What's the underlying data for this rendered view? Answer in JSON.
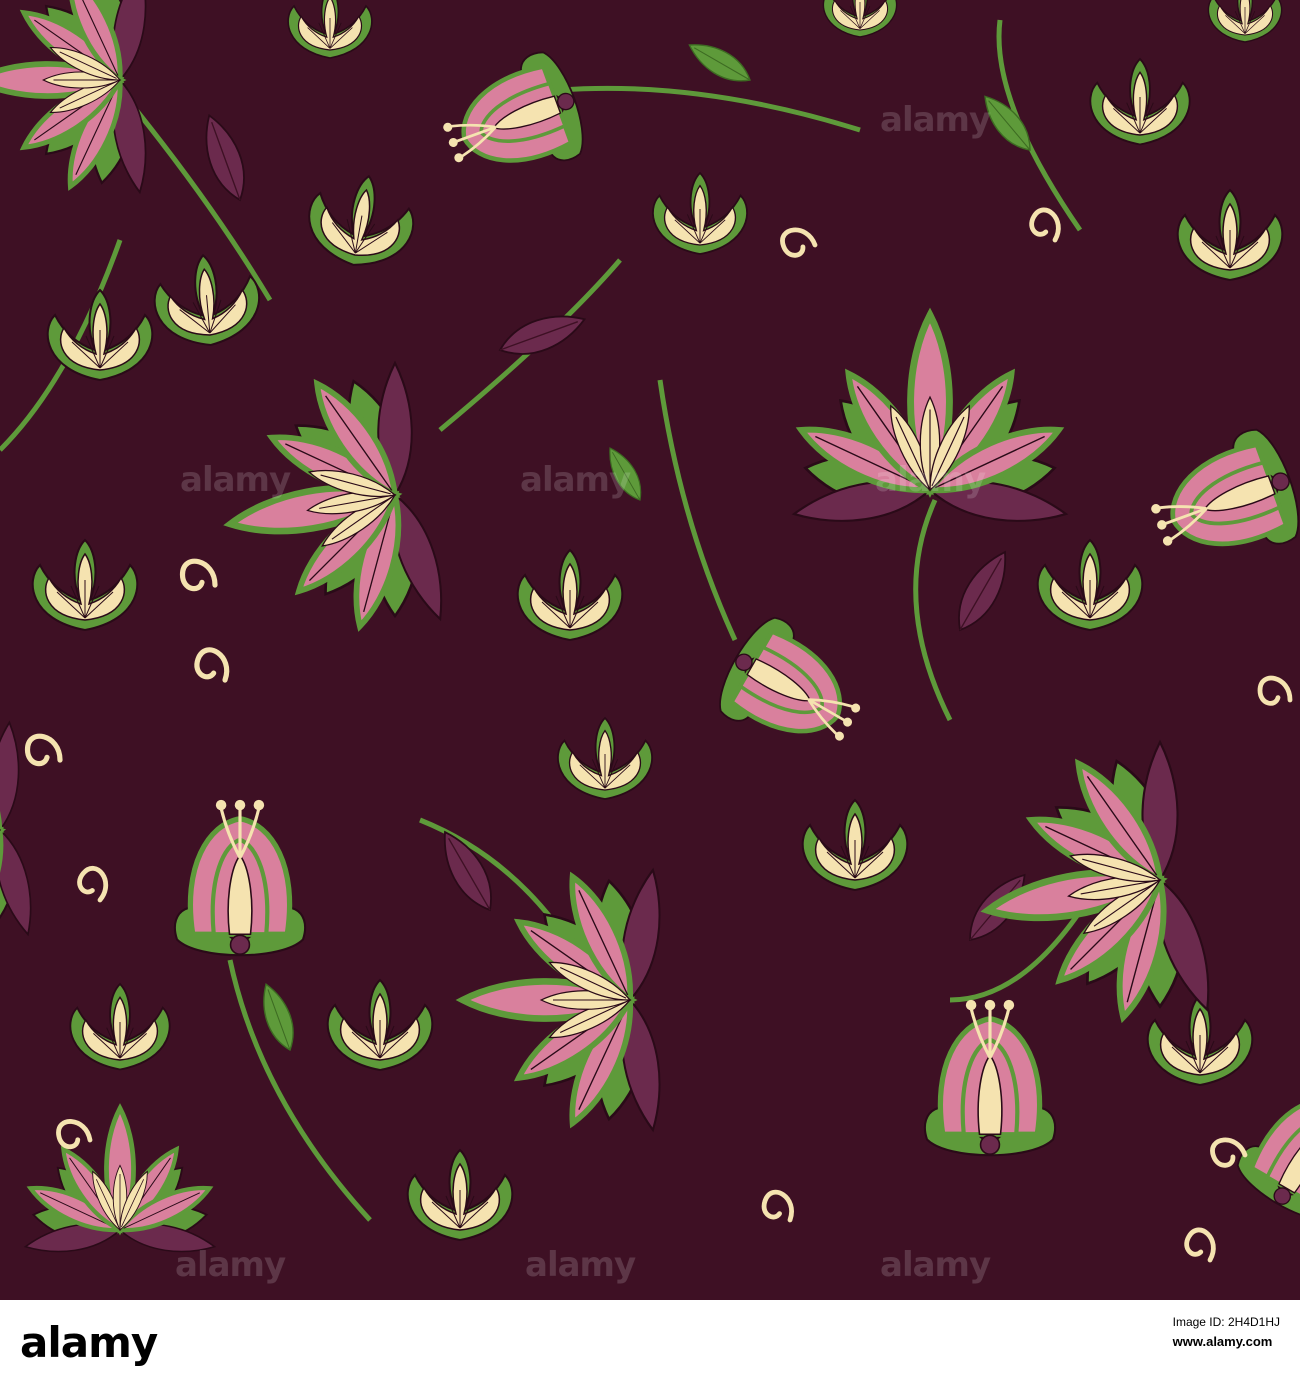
{
  "watermark": {
    "text": "alamy"
  },
  "footer": {
    "logo": "alamy",
    "image_id_label": "Image ID: 2H4D1HJ",
    "site": "www.alamy.com"
  },
  "colors": {
    "background": "#3e1024",
    "petal_pink": "#d9809d",
    "petal_cream": "#f5e3b0",
    "leaf_green": "#5e9a3a",
    "dark_purple": "#6b2a4d"
  }
}
